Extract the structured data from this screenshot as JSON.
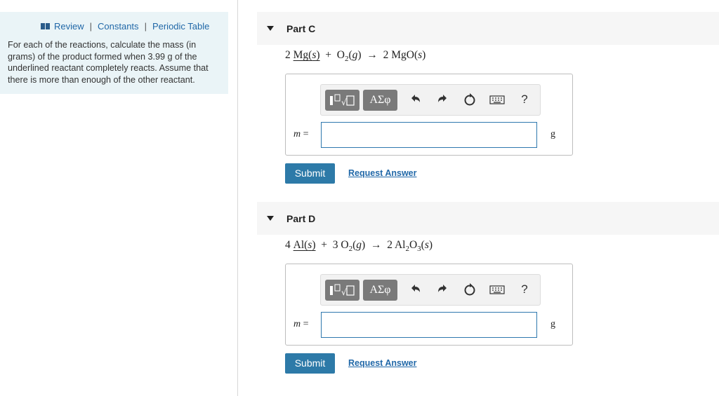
{
  "toolbar_links": {
    "review": "Review",
    "constants": "Constants",
    "periodic_table": "Periodic Table",
    "separator": "|"
  },
  "intro_text": "For each of the reactions, calculate the mass (in grams) of the product formed when 3.99 g of the underlined reactant completely reacts. Assume that there is more than enough of the other reactant.",
  "math_toolbar": {
    "templates_icon": "templates-icon",
    "greek_label": "ΑΣφ",
    "undo_icon": "undo-icon",
    "redo_icon": "redo-icon",
    "reset_icon": "reset-icon",
    "keyboard_icon": "keyboard-icon",
    "help_label": "?"
  },
  "parts": [
    {
      "title": "Part C",
      "equation": {
        "coef1": "2",
        "underlined": "Mg(s)",
        "plus": "+",
        "reactant2": "O₂(g)",
        "arrow": "→",
        "product": "2 MgO(s)"
      },
      "answer": {
        "var": "m",
        "equals": "=",
        "value": "",
        "unit": "g"
      },
      "submit_label": "Submit",
      "request_label": "Request Answer"
    },
    {
      "title": "Part D",
      "equation": {
        "coef1": "4",
        "underlined": "Al(s)",
        "plus": "+",
        "reactant2": "3 O₂(g)",
        "arrow": "→",
        "product": "2 Al₂O₃(s)"
      },
      "answer": {
        "var": "m",
        "equals": "=",
        "value": "",
        "unit": "g"
      },
      "submit_label": "Submit",
      "request_label": "Request Answer"
    }
  ],
  "colors": {
    "accent": "#2d7aa8",
    "link": "#2168a8",
    "left_panel_bg": "#eaf4f7"
  }
}
